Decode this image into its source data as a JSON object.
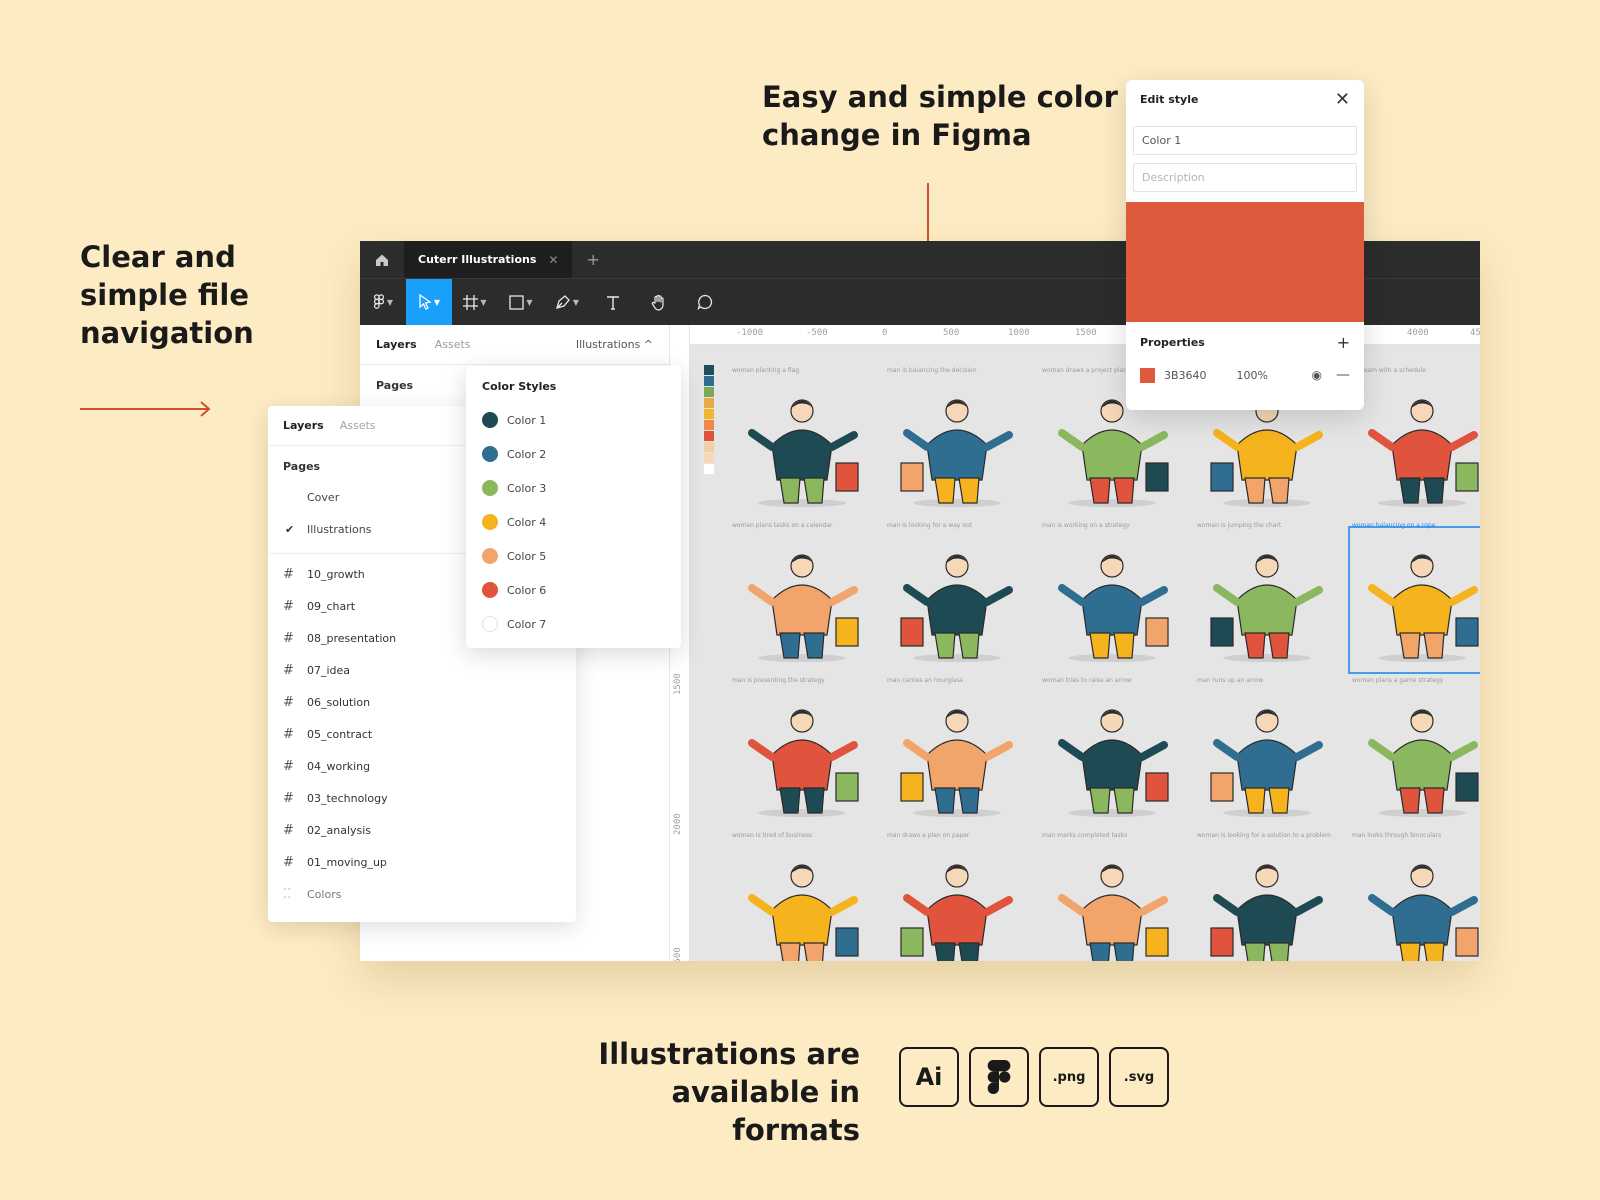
{
  "headlines": {
    "nav": [
      "Clear and",
      "simple file",
      "navigation"
    ],
    "color": [
      "Easy and simple color",
      "change in Figma"
    ],
    "formats": [
      "Illustrations are",
      "available in formats"
    ]
  },
  "figma": {
    "file_tab": "Cuterr Illustrations",
    "left_tabs": {
      "layers": "Layers",
      "assets": "Assets",
      "page_select": "Illustrations ^"
    },
    "pages_title": "Pages",
    "ruler_h": [
      "-1000",
      "-500",
      "0",
      "500",
      "1000",
      "1500",
      "4000",
      "45"
    ],
    "ruler_v": [
      "1500",
      "2000",
      "2500",
      "3000",
      "3500"
    ],
    "canvas_swatches": [
      "#1F4E5A",
      "#2F6E91",
      "#7EA957",
      "#E8A94A",
      "#F1B62C",
      "#F08A4B",
      "#E0533D",
      "#F3CFA7",
      "#F6D7B8",
      "#ffffff"
    ],
    "illustrations": [
      [
        "woman planting a flag",
        "man is balancing the decision",
        "woman draws a project plan",
        "",
        "a dream with a schedule"
      ],
      [
        "woman plans tasks on a calendar",
        "man is looking for a way out",
        "man is working on a strategy",
        "woman is jumping the chart",
        "woman balancing on a rope"
      ],
      [
        "man is presenting the strategy",
        "man carries an hourglass",
        "woman tries to raise an arrow",
        "man runs up an arrow",
        "woman plans a game strategy"
      ],
      [
        "woman is tired of business",
        "man draws a plan on paper",
        "man marks completed tasks",
        "woman is looking for a solution to a problem",
        "man looks through binoculars"
      ]
    ]
  },
  "layers_panel": {
    "tab_layers": "Layers",
    "tab_assets": "Assets",
    "pages_title": "Pages",
    "pages": [
      "Cover",
      "Illustrations"
    ],
    "checked_page": "Illustrations",
    "frames": [
      "10_growth",
      "09_chart",
      "08_presentation",
      "07_idea",
      "06_solution",
      "05_contract",
      "04_working",
      "03_technology",
      "02_analysis",
      "01_moving_up"
    ],
    "colors_row": "Colors"
  },
  "color_styles": {
    "title": "Color Styles",
    "items": [
      {
        "name": "Color 1",
        "color": "#1E4A53"
      },
      {
        "name": "Color 2",
        "color": "#2F6E91"
      },
      {
        "name": "Color 3",
        "color": "#8BB85F"
      },
      {
        "name": "Color 4",
        "color": "#F5B41E"
      },
      {
        "name": "Color 5",
        "color": "#F2A56B"
      },
      {
        "name": "Color 6",
        "color": "#E0533D"
      },
      {
        "name": "Color 7",
        "color": "#FFFFFF"
      }
    ]
  },
  "edit_style": {
    "title": "Edit style",
    "name_value": "Color 1",
    "description_placeholder": "Description",
    "swatch_color": "#DE5A3C",
    "properties_title": "Properties",
    "fill_hex": "3B3640",
    "fill_opacity": "100%"
  },
  "formats": [
    "Ai",
    "Figma",
    ".png",
    ".svg"
  ],
  "accent_color": "#D2502F"
}
